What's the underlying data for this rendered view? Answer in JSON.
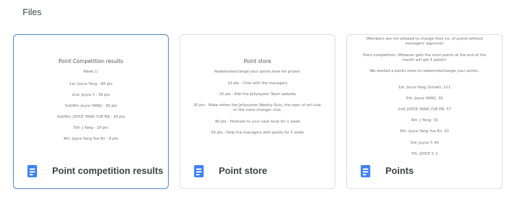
{
  "header": {
    "title": "Files"
  },
  "cards": [
    {
      "label": "Point competition results",
      "icon": "doc-icon",
      "preview": {
        "title": "Point Competition results",
        "lines": [
          "Week 1:",
          "1st: Joyce Yong - 86 pts",
          "2nd: Joyce Y - 36 pts",
          "3rd/4th: Joyce YANG - 30 pts",
          "3rd/4th: JOYCE YANG YUE EN - 30 pts",
          "5th: J Yang - 29 pts",
          "6th: Joyce Yang Yue En - 8 pts"
        ]
      }
    },
    {
      "label": "Point store",
      "icon": "doc-icon",
      "preview": {
        "title": "Point store",
        "lines": [
          "Redeem/exchange your points here for prizes!",
          "10 pts - Chat with the managers",
          "20 pts - Edit the Jellyoyster Team website",
          "30 pts - Make either the Jellyoyster Weekly Quiz, the topic of art club, or the voice changer club.",
          "40 pts - Promote to your next level for 1 week",
          "50 pts - Help the managers with points for 1 week"
        ]
      }
    },
    {
      "label": "Points",
      "icon": "doc-icon",
      "preview": {
        "title": "",
        "lines": [
          "(Members are not allowed to change their no. of points without managers' approval)",
          "Point competition: Whoever gets the most points at the end of the month will get 5 points!",
          "We started a points store to redeem/exchange your points.",
          "1st: Joyce Yang (Gmail): 111",
          "5th: Joyce YANG: 30",
          "2nd: JOYCE YANG YUE EN: 57",
          "4th: J Yong: 33",
          "6th: Joyce Yang Yue En: 10",
          "3rd: Joyce Y: 44",
          "7th: JOYCE Y: 2"
        ]
      }
    }
  ]
}
